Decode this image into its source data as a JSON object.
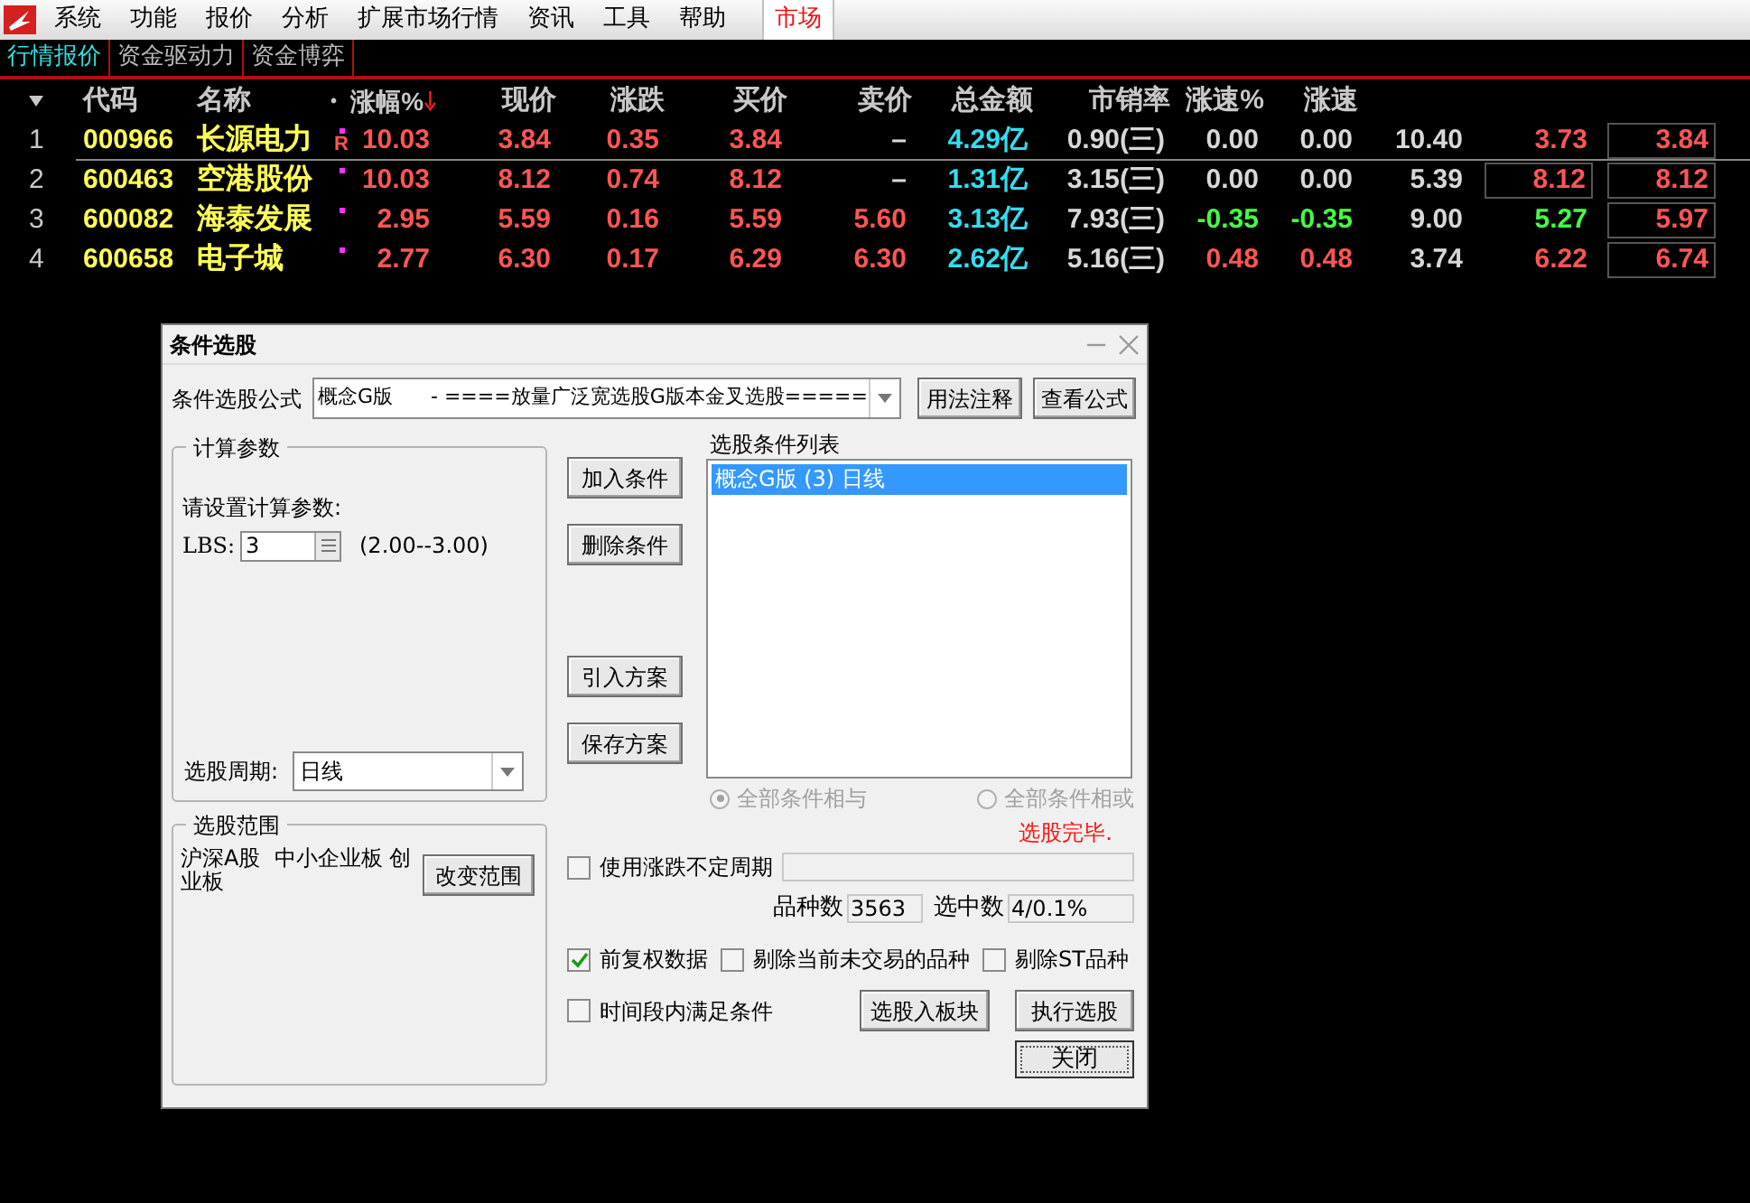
{
  "menu": {
    "items": [
      {
        "label": "系统",
        "selected": false
      },
      {
        "label": "功能",
        "selected": false
      },
      {
        "label": "报价",
        "selected": false
      },
      {
        "label": "分析",
        "selected": false
      },
      {
        "label": "扩展市场行情",
        "selected": false
      },
      {
        "label": "资讯",
        "selected": false
      },
      {
        "label": "工具",
        "selected": false
      },
      {
        "label": "帮助",
        "selected": false
      },
      {
        "label": "市场",
        "selected": true
      }
    ]
  },
  "tabs": [
    {
      "label": "行情报价",
      "selected": true
    },
    {
      "label": "资金驱动力",
      "selected": false
    },
    {
      "label": "资金博弈",
      "selected": false
    }
  ],
  "table": {
    "marker_header": "•",
    "columns": [
      "代码",
      "名称",
      "涨幅%",
      "现价",
      "涨跌",
      "买价",
      "卖价",
      "总金额",
      "市销率",
      "涨速%",
      "涨速"
    ],
    "rows": [
      {
        "index": "1",
        "flag": "R",
        "cells": [
          "000966",
          "长源电力",
          {
            "text": "10.03",
            "color": "#ff5555",
            "boxed": false
          },
          {
            "text": "3.84",
            "color": "#ff5555",
            "boxed": false
          },
          {
            "text": "0.35",
            "color": "#ff5555",
            "boxed": false
          },
          {
            "text": "3.84",
            "color": "#ff5555",
            "boxed": false
          },
          {
            "text": "–",
            "color": "#d8d8d8",
            "boxed": false
          },
          {
            "text": "4.29亿",
            "color": "#33ddee",
            "boxed": false
          },
          {
            "text": "0.90(三)",
            "color": "#d8d8d8",
            "boxed": false
          },
          {
            "text": "0.00",
            "color": "#d8d8d8",
            "boxed": false
          },
          {
            "text": "0.00",
            "color": "#d8d8d8",
            "boxed": false
          },
          {
            "text": "10.40",
            "color": "#d8d8d8",
            "boxed": false
          },
          {
            "text": "3.73",
            "color": "#ff5555",
            "boxed": false
          },
          {
            "text": "3.84",
            "color": "#ff5555",
            "boxed": true
          }
        ]
      },
      {
        "index": "2",
        "cells": [
          "600463",
          "空港股份",
          {
            "text": "10.03",
            "color": "#ff5555",
            "boxed": false
          },
          {
            "text": "8.12",
            "color": "#ff5555",
            "boxed": false
          },
          {
            "text": "0.74",
            "color": "#ff5555",
            "boxed": false
          },
          {
            "text": "8.12",
            "color": "#ff5555",
            "boxed": false
          },
          {
            "text": "–",
            "color": "#d8d8d8",
            "boxed": false
          },
          {
            "text": "1.31亿",
            "color": "#33ddee",
            "boxed": false
          },
          {
            "text": "3.15(三)",
            "color": "#d8d8d8",
            "boxed": false
          },
          {
            "text": "0.00",
            "color": "#d8d8d8",
            "boxed": false
          },
          {
            "text": "0.00",
            "color": "#d8d8d8",
            "boxed": false
          },
          {
            "text": "5.39",
            "color": "#d8d8d8",
            "boxed": false
          },
          {
            "text": "8.12",
            "color": "#ff5555",
            "boxed": true
          },
          {
            "text": "8.12",
            "color": "#ff5555",
            "boxed": true
          }
        ]
      },
      {
        "index": "3",
        "cells": [
          "600082",
          "海泰发展",
          {
            "text": "2.95",
            "color": "#ff5555",
            "boxed": false
          },
          {
            "text": "5.59",
            "color": "#ff5555",
            "boxed": false
          },
          {
            "text": "0.16",
            "color": "#ff5555",
            "boxed": false
          },
          {
            "text": "5.59",
            "color": "#ff5555",
            "boxed": false
          },
          {
            "text": "5.60",
            "color": "#ff5555",
            "boxed": false
          },
          {
            "text": "3.13亿",
            "color": "#33ddee",
            "boxed": false
          },
          {
            "text": "7.93(三)",
            "color": "#d8d8d8",
            "boxed": false
          },
          {
            "text": "-0.35",
            "color": "#44ff44",
            "boxed": false
          },
          {
            "text": "-0.35",
            "color": "#44ff44",
            "boxed": false
          },
          {
            "text": "9.00",
            "color": "#d8d8d8",
            "boxed": false
          },
          {
            "text": "5.27",
            "color": "#44ff44",
            "boxed": false
          },
          {
            "text": "5.97",
            "color": "#ff5555",
            "boxed": true
          }
        ]
      },
      {
        "index": "4",
        "cells": [
          "600658",
          "电子城",
          {
            "text": "2.77",
            "color": "#ff5555",
            "boxed": false
          },
          {
            "text": "6.30",
            "color": "#ff5555",
            "boxed": false
          },
          {
            "text": "0.17",
            "color": "#ff5555",
            "boxed": false
          },
          {
            "text": "6.29",
            "color": "#ff5555",
            "boxed": false
          },
          {
            "text": "6.30",
            "color": "#ff5555",
            "boxed": false
          },
          {
            "text": "2.62亿",
            "color": "#33ddee",
            "boxed": false
          },
          {
            "text": "5.16(三)",
            "color": "#d8d8d8",
            "boxed": false
          },
          {
            "text": "0.48",
            "color": "#ff5555",
            "boxed": false
          },
          {
            "text": "0.48",
            "color": "#ff5555",
            "boxed": false
          },
          {
            "text": "3.74",
            "color": "#d8d8d8",
            "boxed": false
          },
          {
            "text": "6.22",
            "color": "#ff5555",
            "boxed": false
          },
          {
            "text": "6.74",
            "color": "#ff5555",
            "boxed": true
          }
        ]
      }
    ]
  },
  "dialog": {
    "title": "条件选股",
    "formula": {
      "label": "条件选股公式",
      "value": "概念G版      - ====放量广泛宽选股G版本金叉选股=====",
      "buttons": [
        "用法注释",
        "查看公式"
      ]
    },
    "params": {
      "title": "计算参数",
      "prompt": "请设置计算参数:",
      "param_label": "LBS:",
      "param_value": "3",
      "range": "(2.00--3.00)",
      "period_label": "选股周期:",
      "period_value": "日线"
    },
    "scope": {
      "title": "选股范围",
      "text": "沪深A股  中小企业板 创业板",
      "button": "改变范围"
    },
    "side_buttons": [
      "加入条件",
      "删除条件",
      "引入方案",
      "保存方案"
    ],
    "conditions": {
      "label": "选股条件列表",
      "items": [
        {
          "text": "概念G版 (3) 日线",
          "selected": true
        }
      ]
    },
    "logic": [
      {
        "label": "全部条件相与",
        "selected": true
      },
      {
        "label": "全部条件相或",
        "selected": false
      }
    ],
    "status": "选股完毕.",
    "variable_period": {
      "label": "使用涨跌不定周期",
      "checked": false
    },
    "counts": [
      {
        "label": "品种数",
        "value": "3563"
      },
      {
        "label": "选中数",
        "value": "4/0.1%"
      }
    ],
    "options": [
      {
        "label": "前复权数据",
        "checked": true
      },
      {
        "label": "剔除当前未交易的品种",
        "checked": false
      },
      {
        "label": "剔除ST品种",
        "checked": false
      }
    ],
    "time_condition": {
      "label": "时间段内满足条件",
      "checked": false
    },
    "action_buttons": [
      "选股入板块",
      "执行选股"
    ],
    "close_button": "关闭"
  }
}
